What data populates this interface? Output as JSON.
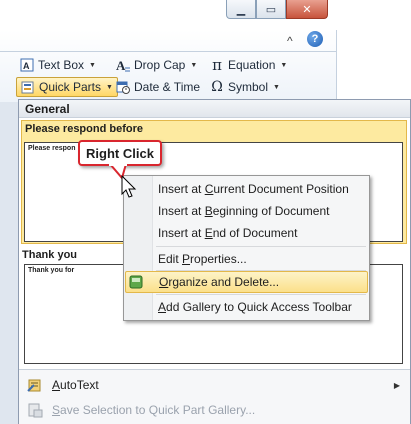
{
  "window_controls": {
    "minimize": "▁",
    "maximize": "▭",
    "close": "✕"
  },
  "ribbon": {
    "text_box": "Text Box",
    "drop_cap": "Drop Cap",
    "equation": "Equation",
    "quick_parts": "Quick Parts",
    "date_time": "Date & Time",
    "symbol": "Symbol",
    "equation_glyph": "π",
    "symbol_glyph": "Ω",
    "help": "?",
    "collapse": "^"
  },
  "gallery": {
    "header": "General",
    "items": [
      {
        "title": "Please respond before",
        "preview": "Please respon"
      },
      {
        "title": "Thank you",
        "preview": "Thank you for"
      }
    ]
  },
  "callout": {
    "text": "Right Click"
  },
  "context_menu": {
    "items": [
      {
        "pre": "Insert at ",
        "key": "C",
        "post": "urrent Document Position"
      },
      {
        "pre": "Insert at ",
        "key": "B",
        "post": "eginning of Document"
      },
      {
        "pre": "Insert at ",
        "key": "E",
        "post": "nd of Document"
      },
      {
        "pre": "Edit ",
        "key": "P",
        "post": "roperties..."
      },
      {
        "pre": "",
        "key": "O",
        "post": "rganize and Delete..."
      },
      {
        "pre": "",
        "key": "A",
        "post": "dd Gallery to Quick Access Toolbar"
      }
    ]
  },
  "bottom_menu": {
    "autotext": {
      "key": "A",
      "rest": "utoText"
    },
    "save_selection": {
      "key": "S",
      "rest": "ave Selection to Quick Part Gallery..."
    }
  },
  "colors": {
    "highlight": "#fdeaa0",
    "highlight_border": "#e3b84a",
    "callout_border": "#d9262e"
  }
}
